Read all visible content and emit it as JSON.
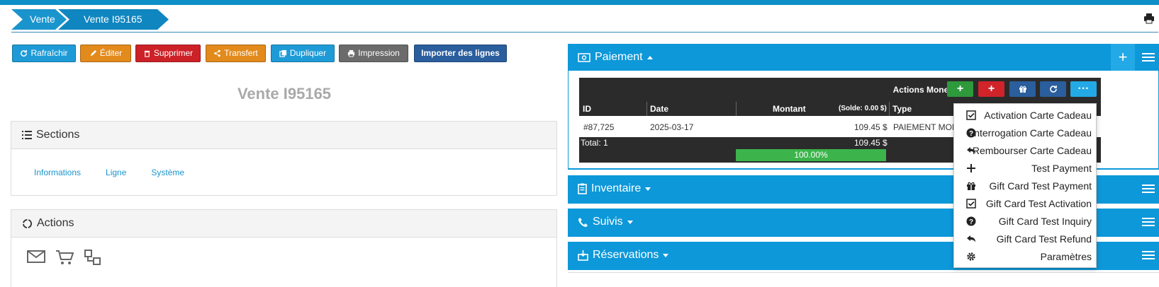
{
  "breadcrumb": {
    "items": [
      "Vente",
      "Vente I95165"
    ]
  },
  "toolbar": {
    "refresh": "Rafraîchir",
    "edit": "Éditer",
    "delete": "Supprimer",
    "transfer": "Transfert",
    "duplicate": "Dupliquer",
    "print": "Impression",
    "import": "Importer des lignes"
  },
  "page_title": "Vente I95165",
  "sections": {
    "title": "Sections",
    "tabs": [
      "Informations",
      "Ligne",
      "Système"
    ]
  },
  "actions": {
    "title": "Actions",
    "icons": [
      "envelope-icon",
      "cart-icon",
      "sitemap-icon"
    ]
  },
  "payment": {
    "title": "Paiement",
    "actions_label": "Actions Moneris",
    "headers": {
      "id": "ID",
      "date": "Date",
      "amount": "Montant",
      "balance": "(Solde: 0.00 $)",
      "type": "Type"
    },
    "rows": [
      {
        "id": "#87,725",
        "date": "2025-03-17",
        "amount": "109.45 $",
        "type": "PAIEMENT MON"
      }
    ],
    "total_label": "Total: 1",
    "total_amount": "109.45 $",
    "progress_label": "100.00%",
    "progress_value": 1.0
  },
  "panels": {
    "inventory": "Inventaire",
    "followups": "Suivis",
    "reservations": "Réservations"
  },
  "menu": {
    "items": [
      {
        "label": "Activation Carte Cadeau",
        "icon": "check-square-icon"
      },
      {
        "label": "Interrogation Carte Cadeau",
        "icon": "question-circle-icon"
      },
      {
        "label": "Rembourser Carte Cadeau",
        "icon": "reply-icon"
      },
      {
        "label": "Test Payment",
        "icon": "plus-icon"
      },
      {
        "label": "Gift Card Test Payment",
        "icon": "gift-icon"
      },
      {
        "label": "Gift Card Test Activation",
        "icon": "check-square-icon"
      },
      {
        "label": "Gift Card Test Inquiry",
        "icon": "question-circle-icon"
      },
      {
        "label": "Gift Card Test Refund",
        "icon": "reply-icon"
      },
      {
        "label": "Paramètres",
        "icon": "gear-icon"
      }
    ]
  },
  "colors": {
    "primary": "#0d98d9",
    "success": "#2e9a3c",
    "danger": "#d0232a",
    "warning": "#e28a1c",
    "dark": "#2b2b2b"
  }
}
